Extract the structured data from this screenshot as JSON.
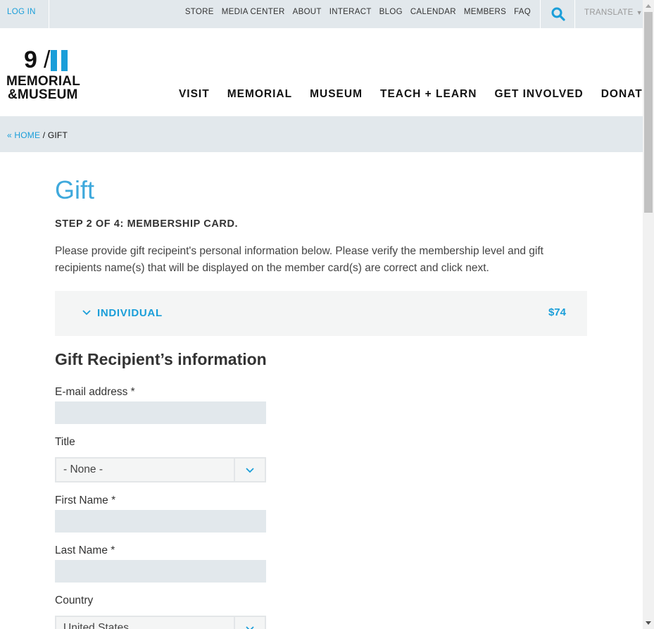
{
  "utility_bar": {
    "login": "LOG IN",
    "links": [
      "STORE",
      "MEDIA CENTER",
      "ABOUT",
      "INTERACT",
      "BLOG",
      "CALENDAR",
      "MEMBERS",
      "FAQ"
    ],
    "search_icon": "search-icon",
    "translate": "TRANSLATE",
    "translate_caret": "▼"
  },
  "logo": {
    "num": "9",
    "slash": "/",
    "line1": "MEMORIAL",
    "line2": "&MUSEUM"
  },
  "main_nav": [
    "VISIT",
    "MEMORIAL",
    "MUSEUM",
    "TEACH + LEARN",
    "GET INVOLVED",
    "DONATE"
  ],
  "breadcrumb": {
    "home": "« HOME",
    "separator": "/",
    "current": "GIFT"
  },
  "page": {
    "title": "Gift",
    "step": "STEP 2 OF 4: MEMBERSHIP CARD.",
    "intro": "Please provide gift recipeint's personal information below. Please verify the membership level and gift recipients name(s) that will be displayed on the member card(s) are correct and click next."
  },
  "membership": {
    "level": "INDIVIDUAL",
    "price": "$74",
    "icon": "chevron-down-icon"
  },
  "form": {
    "section_title": "Gift Recipient’s information",
    "email_label": "E-mail address *",
    "email_value": "",
    "title_label": "Title",
    "title_value": "- None -",
    "first_name_label": "First Name *",
    "first_name_value": "",
    "last_name_label": "Last Name *",
    "last_name_value": "",
    "country_label": "Country",
    "country_value": "United States"
  },
  "colors": {
    "accent": "#1a9ed9",
    "title_blue": "#3fa9dc",
    "bar_bg": "#e2e8ec",
    "panel_bg": "#f4f5f5"
  }
}
